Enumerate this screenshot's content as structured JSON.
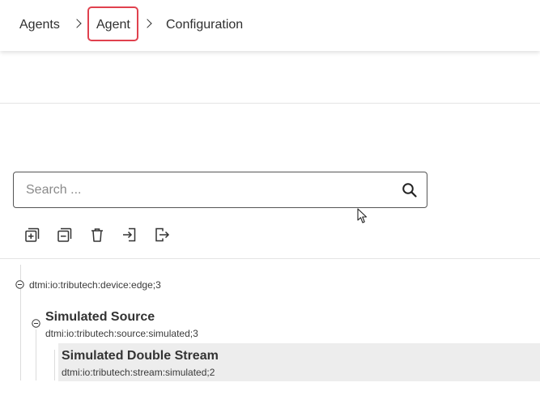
{
  "breadcrumb": {
    "items": [
      {
        "label": "Agents"
      },
      {
        "label": "Agent"
      },
      {
        "label": "Configuration"
      }
    ],
    "highlight_color": "#e0414e"
  },
  "search": {
    "placeholder": "Search ...",
    "value": "",
    "icon": "search-icon"
  },
  "toolbar": {
    "icons": [
      "expand-all-icon",
      "collapse-all-icon",
      "delete-icon",
      "import-icon",
      "export-icon"
    ]
  },
  "tree": {
    "root": {
      "id": "dtmi:io:tributech:device:edge;3",
      "expanded": true
    },
    "child": {
      "title": "Simulated Source",
      "id": "dtmi:io:tributech:source:simulated;3",
      "expanded": true
    },
    "grandchild": {
      "title": "Simulated Double Stream",
      "id": "dtmi:io:tributech:stream:simulated;2",
      "selected": true,
      "selected_color": "#ededed"
    }
  }
}
